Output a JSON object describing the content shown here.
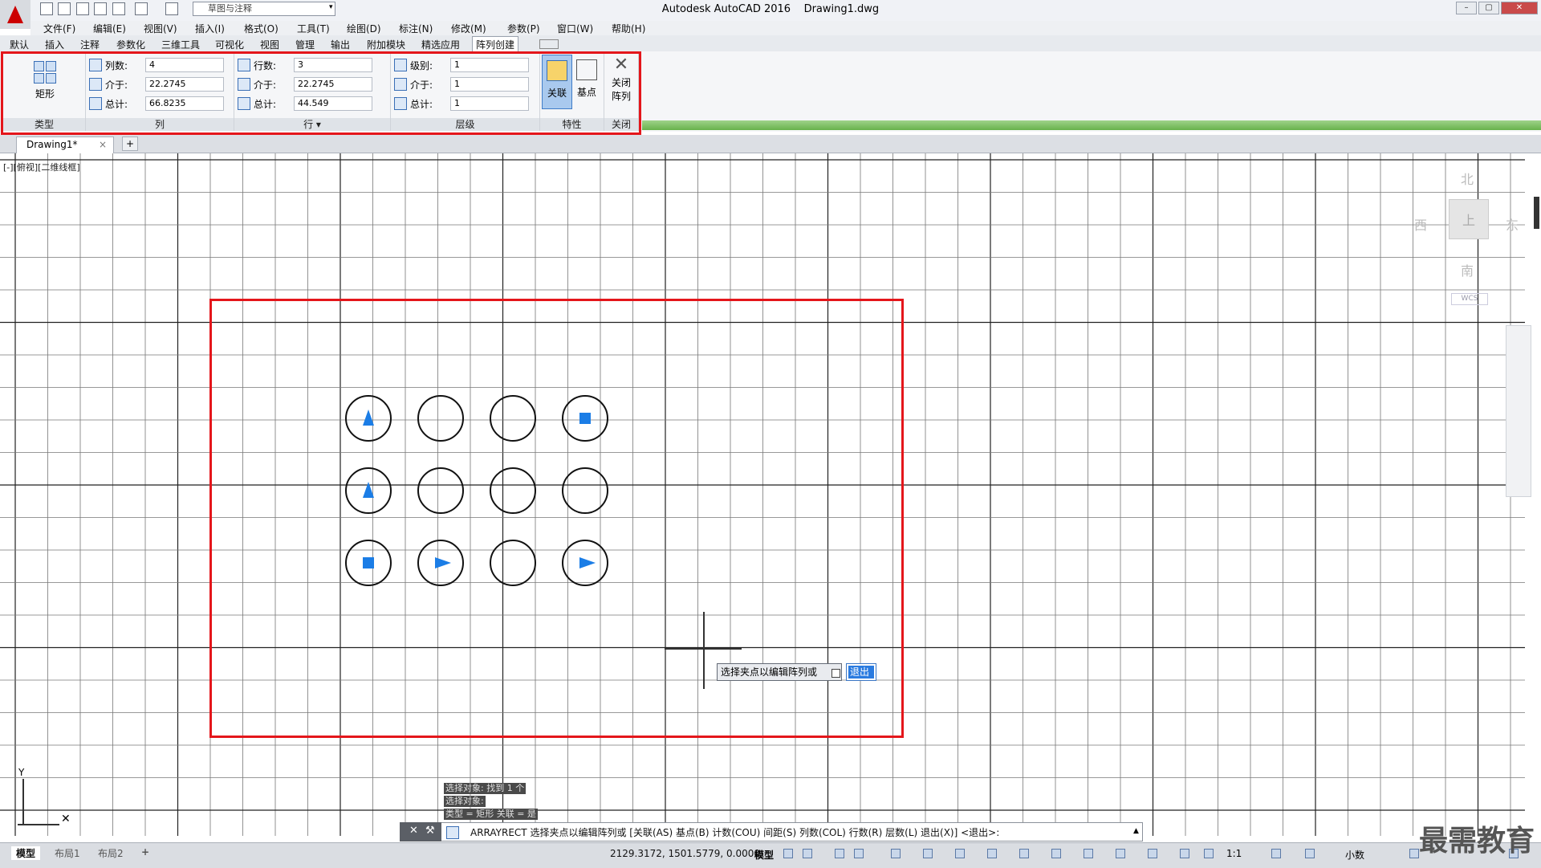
{
  "window": {
    "title": "Autodesk AutoCAD 2016",
    "filename": "Drawing1.dwg",
    "workspace": "草图与注释"
  },
  "menubar": [
    "文件(F)",
    "编辑(E)",
    "视图(V)",
    "插入(I)",
    "格式(O)",
    "工具(T)",
    "绘图(D)",
    "标注(N)",
    "修改(M)",
    "参数(P)",
    "窗口(W)",
    "帮助(H)"
  ],
  "ribbon_tabs": [
    "默认",
    "插入",
    "注释",
    "参数化",
    "三维工具",
    "可视化",
    "视图",
    "管理",
    "输出",
    "附加模块",
    "精选应用",
    "阵列创建"
  ],
  "ribbon": {
    "type_panel": {
      "button": "矩形",
      "title": "类型"
    },
    "columns_panel": {
      "title": "列",
      "rows": [
        {
          "label": "列数:",
          "value": "4"
        },
        {
          "label": "介于:",
          "value": "22.2745"
        },
        {
          "label": "总计:",
          "value": "66.8235"
        }
      ]
    },
    "rows_panel": {
      "title": "行 ▾",
      "rows": [
        {
          "label": "行数:",
          "value": "3"
        },
        {
          "label": "介于:",
          "value": "22.2745"
        },
        {
          "label": "总计:",
          "value": "44.549"
        }
      ]
    },
    "levels_panel": {
      "title": "层级",
      "rows": [
        {
          "label": "级别:",
          "value": "1"
        },
        {
          "label": "介于:",
          "value": "1"
        },
        {
          "label": "总计:",
          "value": "1"
        }
      ]
    },
    "properties_panel": {
      "title": "特性",
      "associate": "关联",
      "basepoint": "基点"
    },
    "close_panel": {
      "title": "关闭",
      "button_line1": "关闭",
      "button_line2": "阵列"
    }
  },
  "doc_tab": {
    "label": "Drawing1*",
    "close": "×",
    "add": "+"
  },
  "view_label": "[-][俯视][二维线框]",
  "viewcube": {
    "north": "北",
    "south": "南",
    "east": "东",
    "west": "西",
    "top": "上",
    "wcs": "WCS"
  },
  "tooltip": {
    "text": "选择夹点以编辑阵列或",
    "exit": "退出"
  },
  "command_history": [
    "选择对象: 找到 1 个",
    "选择对象:",
    "类型 = 矩形  关联 = 是"
  ],
  "command_line": "ARRAYRECT 选择夹点以编辑阵列或 [关联(AS) 基点(B) 计数(COU) 间距(S) 列数(COL) 行数(R) 层数(L) 退出(X)] <退出>:",
  "layout_tabs": [
    "模型",
    "布局1",
    "布局2"
  ],
  "status": {
    "coords": "2129.3172, 1501.5779, 0.0000",
    "model": "模型",
    "scale": "1:1",
    "units": "小数"
  },
  "watermark": "最需教育",
  "colors": {
    "accent": "#1b7de6",
    "highlight_frame": "#e4161b",
    "grid": "#1a1a1a"
  }
}
